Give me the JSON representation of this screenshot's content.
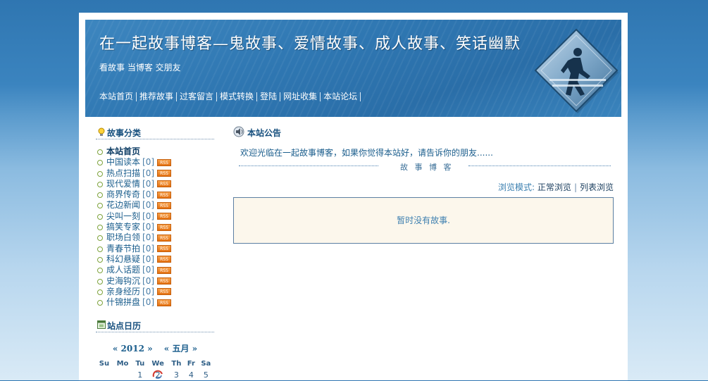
{
  "header": {
    "title": "在一起故事博客—鬼故事、爱情故事、成人故事、笑话幽默",
    "subtitle": "看故事 当博客 交朋友",
    "nav": [
      "本站首页",
      "推荐故事",
      "过客留言",
      "模式转换",
      "登陆",
      "网址收集",
      "本站论坛"
    ]
  },
  "sidebar": {
    "categories_title": "故事分类",
    "categories": [
      {
        "name": "本站首页",
        "count": "",
        "rss": ""
      },
      {
        "name": "中国读本",
        "count": "[0]",
        "rss": "RSS"
      },
      {
        "name": "热点扫描",
        "count": "[0]",
        "rss": "RSS"
      },
      {
        "name": "现代爱情",
        "count": "[0]",
        "rss": "RSS"
      },
      {
        "name": "商界传奇",
        "count": "[0]",
        "rss": "RSS"
      },
      {
        "name": "花边新闻",
        "count": "[0]",
        "rss": "RSS"
      },
      {
        "name": "尖叫一刻",
        "count": "[0]",
        "rss": "RSS"
      },
      {
        "name": "搞笑专家",
        "count": "[0]",
        "rss": "RSS"
      },
      {
        "name": "职场白领",
        "count": "[0]",
        "rss": "RSS"
      },
      {
        "name": "青春节拍",
        "count": "[0]",
        "rss": "RSS"
      },
      {
        "name": "科幻悬疑",
        "count": "[0]",
        "rss": "RSS"
      },
      {
        "name": "成人话题",
        "count": "[0]",
        "rss": "RSS"
      },
      {
        "name": "史海钩沉",
        "count": "[0]",
        "rss": "RSS"
      },
      {
        "name": "亲身经历",
        "count": "[0]",
        "rss": "RSS"
      },
      {
        "name": "什锦拼盘",
        "count": "[0]",
        "rss": "RSS"
      }
    ],
    "calendar_title": "站点日历",
    "calendar": {
      "year_label": "« 2012 »",
      "month_label": "« 五月 »",
      "weekdays": [
        "Su",
        "Mo",
        "Tu",
        "We",
        "Th",
        "Fr",
        "Sa"
      ],
      "first_row": [
        "",
        "",
        "1",
        "2",
        "3",
        "4",
        "5"
      ]
    }
  },
  "main": {
    "notice_title": "本站公告",
    "notice_text": "欢迎光临在一起故事博客，如果你觉得本站好，请告诉你的朋友......",
    "divider_label": "故 事 博 客",
    "browse_prefix": "浏览模式:",
    "browse_normal": "正常浏览",
    "browse_sep": "|",
    "browse_list": "列表浏览",
    "empty_message": "暂时没有故事."
  },
  "colors": {
    "header_blue": "#2f77b2",
    "link_blue": "#1a5d8c",
    "box_bg": "#fcf7ec"
  }
}
